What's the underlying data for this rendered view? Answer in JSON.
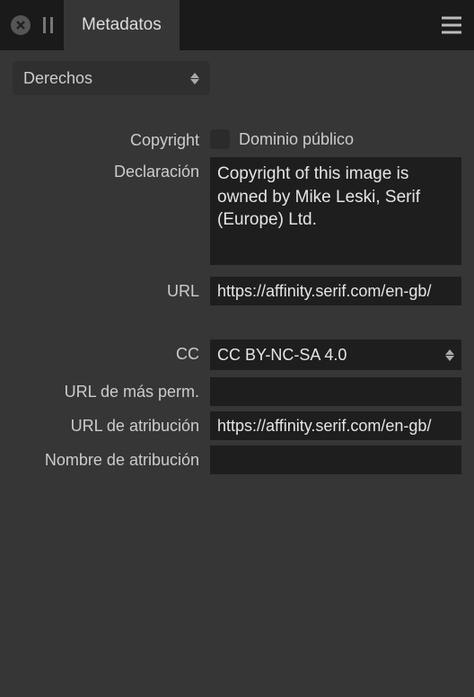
{
  "panel": {
    "title": "Metadatos"
  },
  "category": {
    "selected": "Derechos"
  },
  "labels": {
    "copyright": "Copyright",
    "declaration": "Declaración",
    "url": "URL",
    "cc": "CC",
    "more_perm_url": "URL de más perm.",
    "attribution_url": "URL de atribución",
    "attribution_name": "Nombre de atribución",
    "public_domain": "Dominio público"
  },
  "fields": {
    "public_domain_checked": false,
    "declaration": "Copyright of this image is owned by Mike Leski, Serif (Europe) Ltd.",
    "url": "https://affinity.serif.com/en-gb/",
    "cc_selected": "CC BY-NC-SA 4.0",
    "more_perm_url": "",
    "attribution_url": "https://affinity.serif.com/en-gb/",
    "attribution_name": ""
  }
}
